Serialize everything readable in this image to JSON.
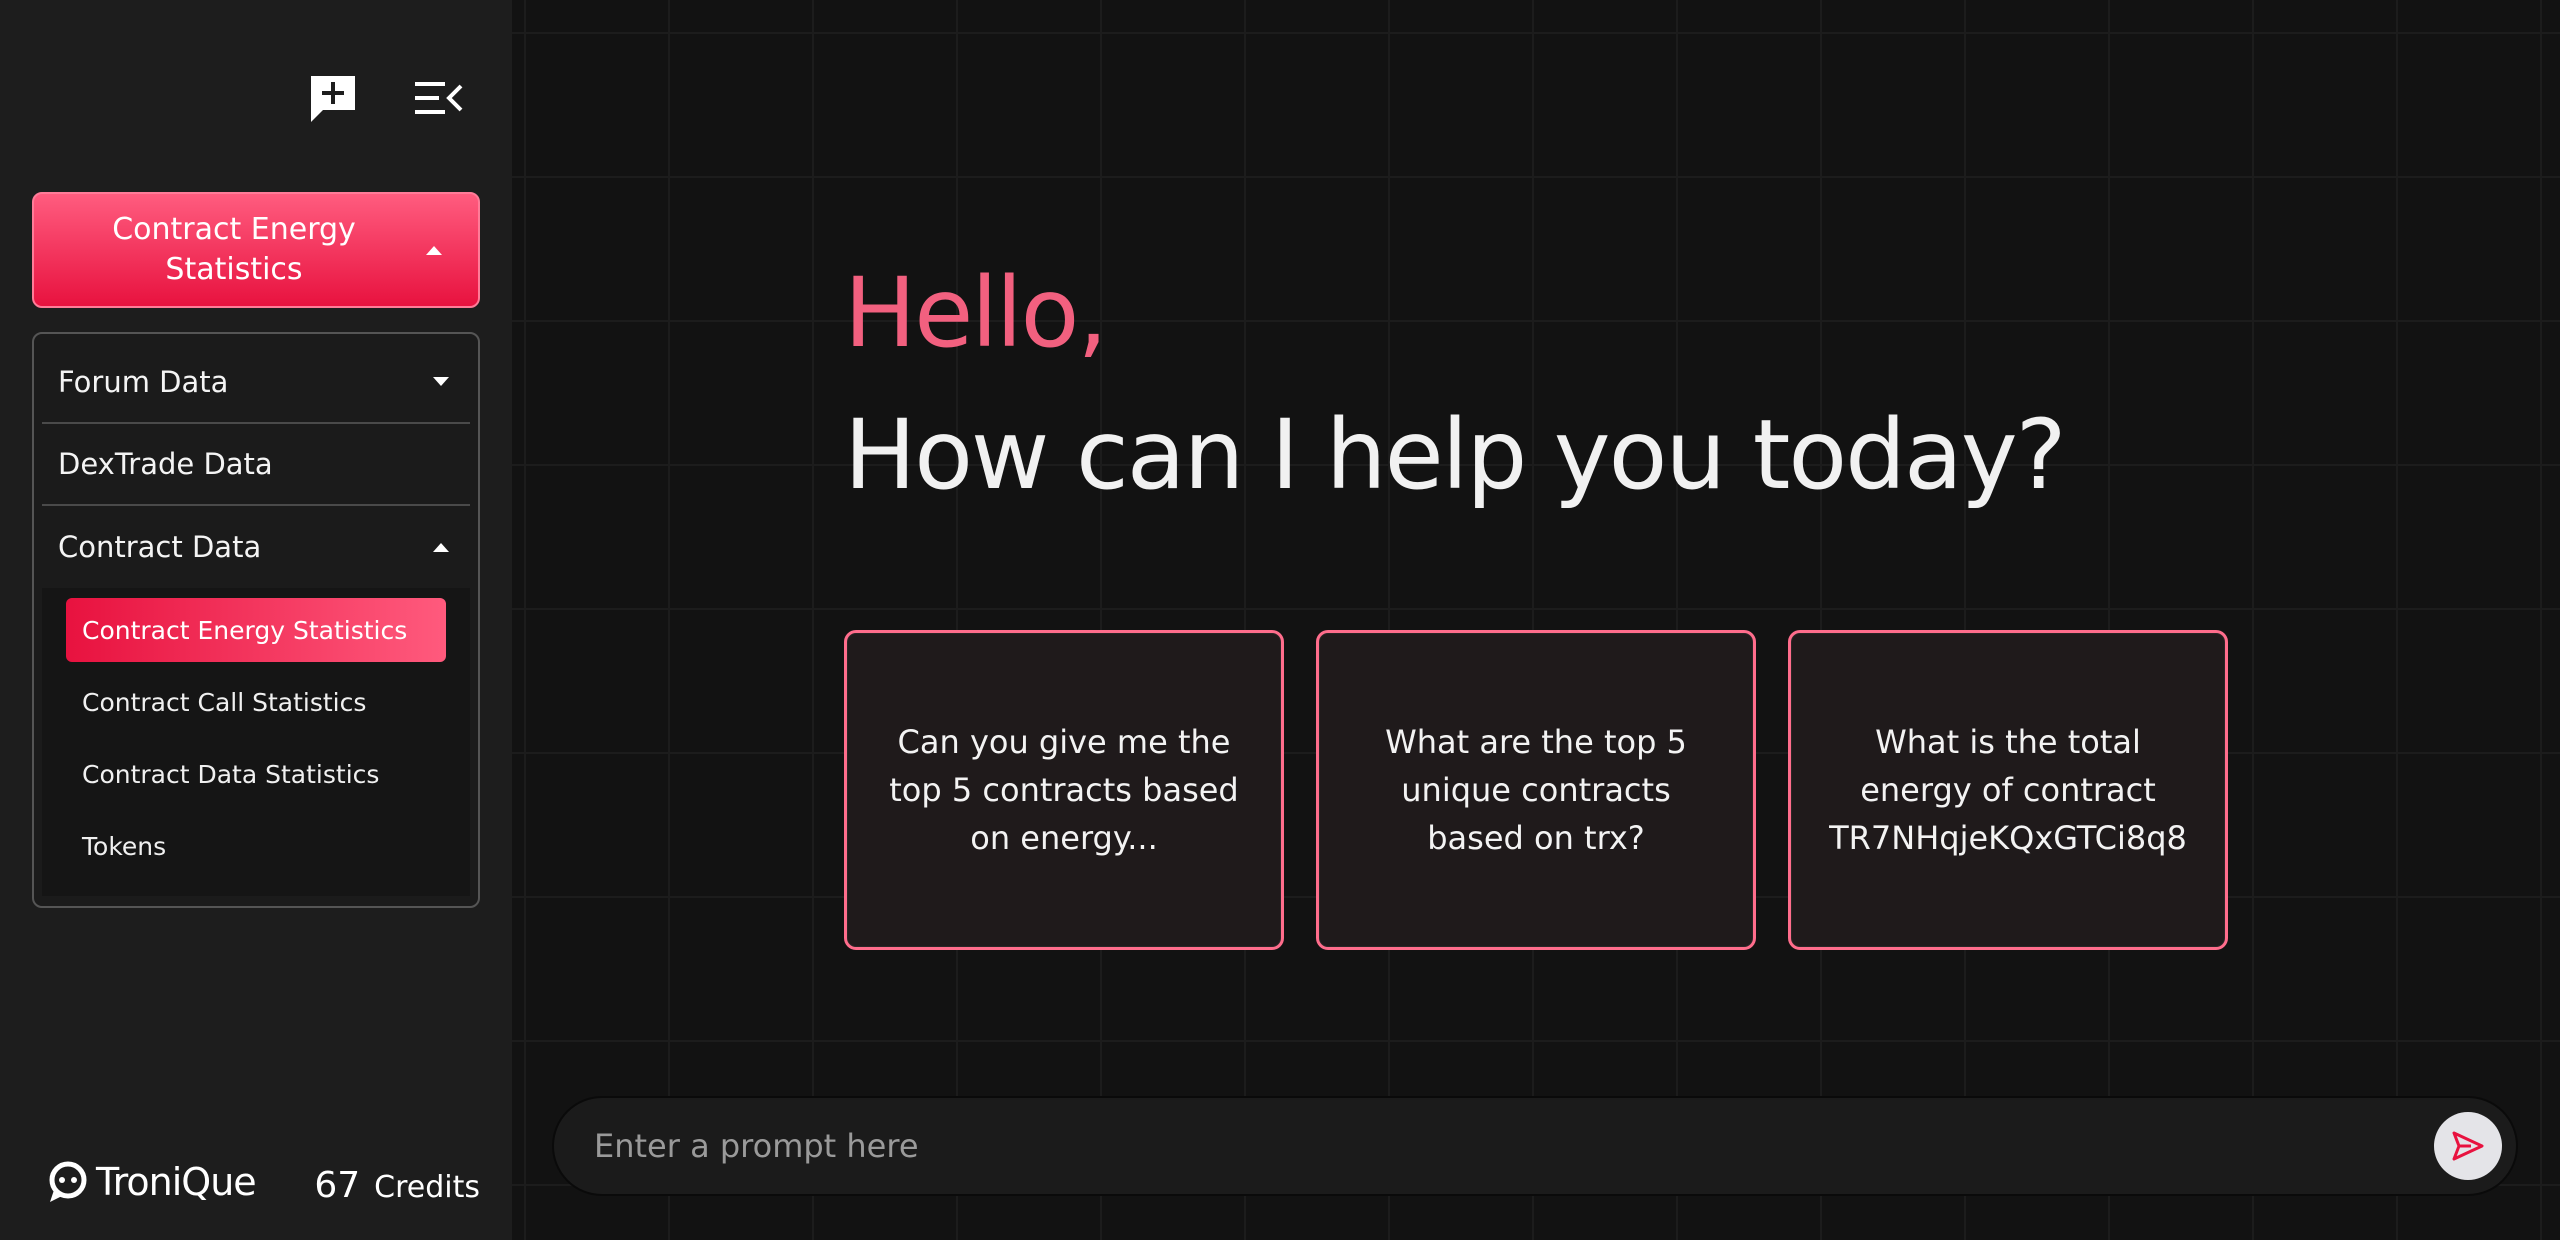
{
  "sidebar": {
    "dataset_dropdown": {
      "label": "Contract Energy Statistics"
    },
    "menu": [
      {
        "label": "Forum Data"
      },
      {
        "label": "DexTrade Data"
      },
      {
        "label": "Contract Data"
      }
    ],
    "submenu": [
      {
        "label": "Contract Energy Statistics",
        "active": true
      },
      {
        "label": "Contract Call Statistics"
      },
      {
        "label": "Contract Data Statistics"
      },
      {
        "label": "Tokens"
      }
    ],
    "brand": "TroniQue",
    "credits": {
      "count": "67",
      "label": "Credits"
    }
  },
  "main": {
    "greeting": "Hello,",
    "headline": "How can I help you today?",
    "cards": [
      {
        "text": "Can you give me the top 5 contracts based on energy..."
      },
      {
        "text": "What are the top 5 unique contracts based on trx?"
      },
      {
        "text": "What is the total energy of contract TR7NHqjeKQxGTCi8q8"
      }
    ],
    "prompt": {
      "placeholder": "Enter a prompt here",
      "value": ""
    }
  },
  "colors": {
    "accent": "#e8123f",
    "accent_light": "#ff5c7f",
    "greeting": "#f2607f",
    "sidebar_bg": "#1d1d1d",
    "main_bg": "#121212"
  }
}
